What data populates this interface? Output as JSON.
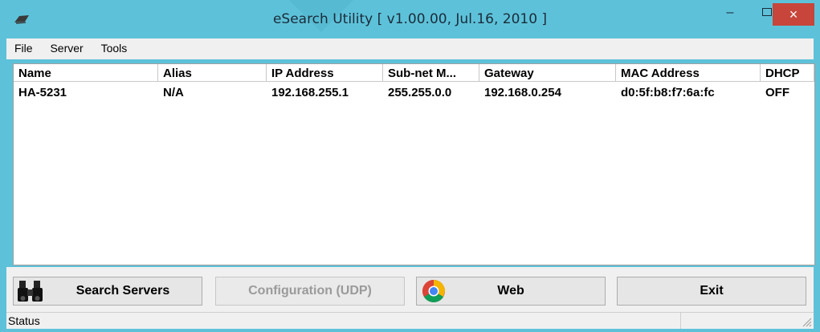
{
  "window": {
    "title": "eSearch Utility [ v1.00.00, Jul.16, 2010 ]",
    "close_glyph": "×",
    "accent_color": "#5dc2d9",
    "close_color": "#c7453b"
  },
  "menu": {
    "items": [
      "File",
      "Server",
      "Tools"
    ]
  },
  "table": {
    "columns": [
      "Name",
      "Alias",
      "IP Address",
      "Sub-net M...",
      "Gateway",
      "MAC Address",
      "DHCP"
    ],
    "rows": [
      [
        "HA-5231",
        "N/A",
        "192.168.255.1",
        "255.255.0.0",
        "192.168.0.254",
        "d0:5f:b8:f7:6a:fc",
        "OFF"
      ]
    ]
  },
  "buttons": {
    "search": {
      "label": "Search Servers",
      "icon": "binoculars-icon"
    },
    "configuration": {
      "label": "Configuration (UDP)",
      "disabled": true
    },
    "web": {
      "label": "Web",
      "icon": "chrome-icon"
    },
    "exit": {
      "label": "Exit"
    }
  },
  "status": {
    "text": "Status"
  }
}
